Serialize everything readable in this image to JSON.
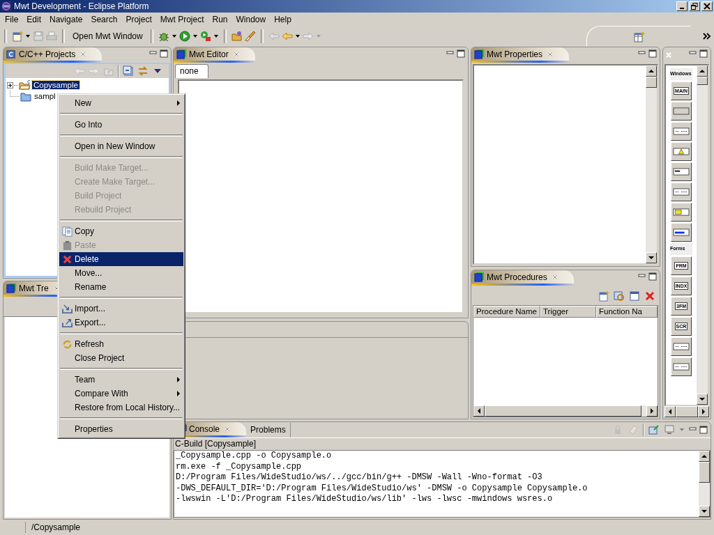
{
  "window": {
    "title": "Mwt Development - Eclipse Platform"
  },
  "menu_bar": [
    "File",
    "Edit",
    "Navigate",
    "Search",
    "Project",
    "Mwt Project",
    "Run",
    "Window",
    "Help"
  ],
  "toolbar": {
    "open_button": "Open Mwt Window"
  },
  "projects_view": {
    "tab": "C/C++ Projects",
    "tree": [
      {
        "label": "Copysample",
        "selected": true,
        "expanded": false
      },
      {
        "label": "sampl",
        "selected": false
      }
    ]
  },
  "tree_view": {
    "tab": "Mwt Tre"
  },
  "editor": {
    "tab": "Mwt Editor",
    "subtabs": [
      {
        "label": "none",
        "selected": true
      }
    ]
  },
  "properties": {
    "tab": "Mwt Properties"
  },
  "procedures": {
    "tab": "Mwt Procedures",
    "columns": [
      "Procedure Name",
      "Trigger",
      "Function Na"
    ]
  },
  "palette": {
    "sections": [
      {
        "label": "Windows",
        "items": [
          {
            "kind": "text",
            "label": "MAIN"
          },
          {
            "kind": "plain"
          },
          {
            "kind": "dialog"
          },
          {
            "kind": "warning"
          },
          {
            "kind": "input"
          },
          {
            "kind": "dialog"
          },
          {
            "kind": "folder"
          },
          {
            "kind": "bar"
          }
        ]
      },
      {
        "label": "Forms",
        "items": [
          {
            "kind": "text",
            "label": "FRM"
          },
          {
            "kind": "text",
            "label": "INDX"
          },
          {
            "kind": "text",
            "label": "3FM"
          },
          {
            "kind": "text",
            "label": "SCR"
          },
          {
            "kind": "dialog"
          },
          {
            "kind": "dialog"
          }
        ]
      }
    ]
  },
  "console": {
    "tabs": [
      {
        "label": "Console",
        "selected": true
      },
      {
        "label": "Problems",
        "selected": false
      }
    ],
    "header": "C-Build [Copysample]",
    "lines": [
      "_Copysample.cpp -o Copysample.o",
      "rm.exe -f _Copysample.cpp",
      "D:/Program Files/WideStudio/ws/../gcc/bin/g++ -DMSW -Wall -Wno-format -O3",
      "-DWS_DEFAULT_DIR='D:/Program Files/WideStudio/ws' -DMSW -o Copysample Copysample.o",
      "-lwswin -L'D:/Program Files/WideStudio/ws/lib' -lws -lwsc -mwindows wsres.o"
    ]
  },
  "status_bar": {
    "text": "/Copysample"
  },
  "context_menu": [
    {
      "kind": "item",
      "label": "New",
      "disabled": false,
      "selected": false,
      "submenu": true
    },
    {
      "kind": "separator"
    },
    {
      "kind": "item",
      "label": "Go Into",
      "disabled": false,
      "selected": false,
      "submenu": false
    },
    {
      "kind": "separator"
    },
    {
      "kind": "item",
      "label": "Open in New Window",
      "disabled": false,
      "selected": false,
      "submenu": false
    },
    {
      "kind": "separator"
    },
    {
      "kind": "item",
      "label": "Build Make Target...",
      "disabled": true,
      "selected": false,
      "submenu": false
    },
    {
      "kind": "item",
      "label": "Create Make Target...",
      "disabled": true,
      "selected": false,
      "submenu": false
    },
    {
      "kind": "item",
      "label": "Build Project",
      "disabled": true,
      "selected": false,
      "submenu": false
    },
    {
      "kind": "item",
      "label": "Rebuild Project",
      "disabled": true,
      "selected": false,
      "submenu": false
    },
    {
      "kind": "separator"
    },
    {
      "kind": "item",
      "label": "Copy",
      "disabled": false,
      "selected": false,
      "submenu": false
    },
    {
      "kind": "item",
      "label": "Paste",
      "disabled": true,
      "selected": false,
      "submenu": false
    },
    {
      "kind": "item",
      "label": "Delete",
      "disabled": false,
      "selected": true,
      "submenu": false
    },
    {
      "kind": "item",
      "label": "Move...",
      "disabled": false,
      "selected": false,
      "submenu": false
    },
    {
      "kind": "item",
      "label": "Rename",
      "disabled": false,
      "selected": false,
      "submenu": false
    },
    {
      "kind": "separator"
    },
    {
      "kind": "item",
      "label": "Import...",
      "disabled": false,
      "selected": false,
      "submenu": false
    },
    {
      "kind": "item",
      "label": "Export...",
      "disabled": false,
      "selected": false,
      "submenu": false
    },
    {
      "kind": "separator"
    },
    {
      "kind": "item",
      "label": "Refresh",
      "disabled": false,
      "selected": false,
      "submenu": false
    },
    {
      "kind": "item",
      "label": "Close Project",
      "disabled": false,
      "selected": false,
      "submenu": false
    },
    {
      "kind": "separator"
    },
    {
      "kind": "item",
      "label": "Team",
      "disabled": false,
      "selected": false,
      "submenu": true
    },
    {
      "kind": "item",
      "label": "Compare With",
      "disabled": false,
      "selected": false,
      "submenu": true
    },
    {
      "kind": "item",
      "label": "Restore from Local History...",
      "disabled": false,
      "selected": false,
      "submenu": false
    },
    {
      "kind": "separator"
    },
    {
      "kind": "item",
      "label": "Properties",
      "disabled": false,
      "selected": false,
      "submenu": false
    }
  ]
}
